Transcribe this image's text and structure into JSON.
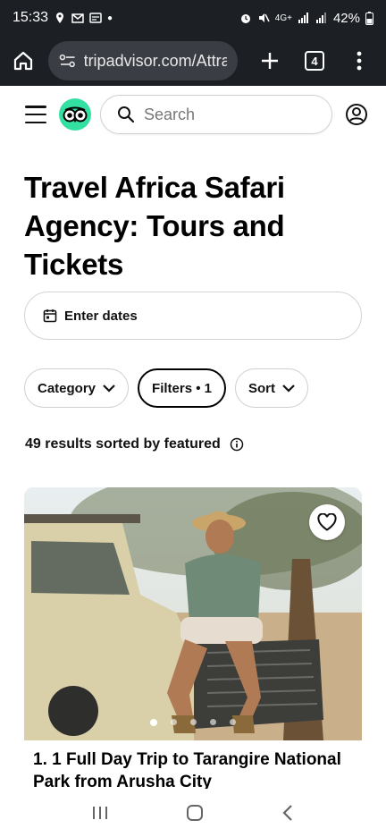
{
  "status_bar": {
    "time": "15:33",
    "network": "4G+",
    "battery": "42%"
  },
  "browser": {
    "url": "tripadvisor.com/Attra",
    "tab_count": "4"
  },
  "header": {
    "search_placeholder": "Search",
    "logo_color": "#34e0a1"
  },
  "page": {
    "title": "Travel Africa Safari Agency: Tours and Tickets",
    "dates_label": "Enter dates",
    "pills": [
      {
        "label": "Category"
      },
      {
        "label": "Filters • 1"
      },
      {
        "label": "Sort"
      }
    ],
    "results_text": "49 results sorted by featured"
  },
  "card": {
    "title": "1. 1 Full Day Trip to Tarangire National Park from Arusha City",
    "active_dot": 1,
    "dot_count": 5
  }
}
